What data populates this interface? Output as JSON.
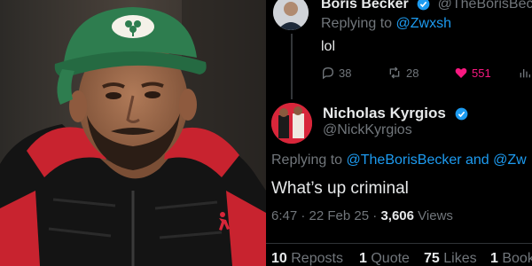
{
  "colors": {
    "background": "#000000",
    "text": "#e7e9ea",
    "muted": "#71767b",
    "link": "#1d9bf0",
    "like": "#f91880",
    "verified": "#1d9bf0"
  },
  "photo": {
    "cap_logo_icon": "shamrock-icon",
    "jacket_logo_icon": "jumpman-icon"
  },
  "parent_tweet": {
    "author_name": "Boris Becker",
    "author_handle": "@TheBorisBecker",
    "replying_label": "Replying to",
    "replying_to": "@Zwxsh",
    "text": "lol",
    "replies": "38",
    "reposts": "28",
    "likes": "551"
  },
  "main_tweet": {
    "author_name": "Nicholas Kyrgios",
    "author_handle": "@NickKyrgios",
    "replying_label": "Replying to",
    "replying_to": "@TheBorisBecker and @Zw",
    "text": "What’s up criminal",
    "time": "6:47",
    "date": "22 Feb 25",
    "separator": "·",
    "views_count": "3,606",
    "views_label": "Views",
    "reposts_count": "10",
    "reposts_label": "Reposts",
    "quotes_count": "1",
    "quotes_label": "Quote",
    "likes_count": "75",
    "likes_label": "Likes",
    "bookmarks_count": "1",
    "bookmarks_label": "Book"
  }
}
